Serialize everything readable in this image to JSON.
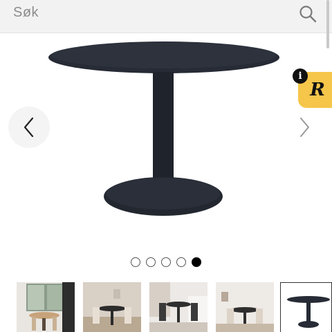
{
  "search": {
    "text": "Søk",
    "icon": "search-icon"
  },
  "product": {
    "image_icon": "round-dining-table-image",
    "table_color": "#252a34"
  },
  "carousel": {
    "prev_icon": "chevron-left-icon",
    "next_icon": "chevron-right-icon",
    "dot_count": 5,
    "active_index": 4
  },
  "badge": {
    "letter": "R",
    "info_letter": "i",
    "color": "#f5c64a"
  },
  "thumbnails": [
    {
      "name": "thumbnail-room-window"
    },
    {
      "name": "thumbnail-dining-beige"
    },
    {
      "name": "thumbnail-dining-grey"
    },
    {
      "name": "thumbnail-dining-light"
    },
    {
      "name": "thumbnail-table-product"
    }
  ],
  "selected_thumbnail_index": 4
}
